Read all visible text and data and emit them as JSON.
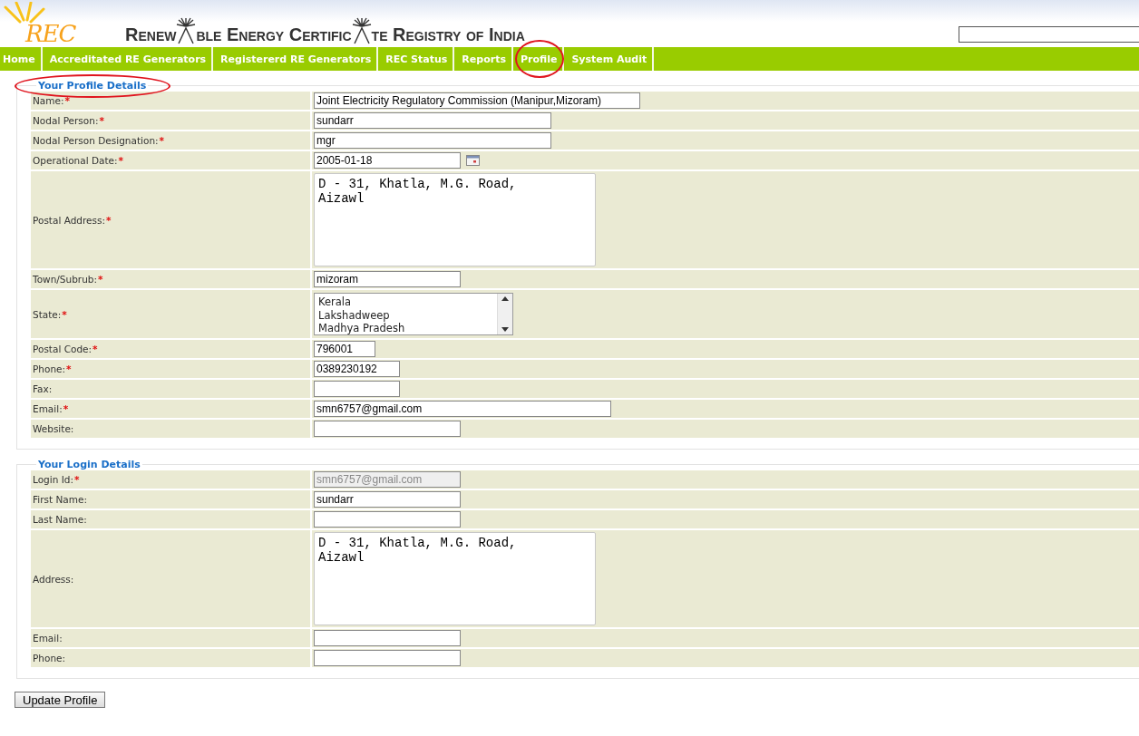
{
  "header": {
    "logo": "REC",
    "title_parts": [
      "Renew",
      "ble Energy Certific",
      "te Registry of India"
    ]
  },
  "nav": [
    {
      "label": "Home",
      "circled": false
    },
    {
      "label": "Accreditated RE Generators",
      "circled": false
    },
    {
      "label": "Registererd RE Generators",
      "circled": false
    },
    {
      "label": "REC Status",
      "circled": false
    },
    {
      "label": "Reports",
      "circled": false
    },
    {
      "label": "Profile",
      "circled": true
    },
    {
      "label": "System Audit",
      "circled": false
    }
  ],
  "sections": [
    {
      "title": "Your Profile Details",
      "circled": true,
      "rows": [
        {
          "kind": "text",
          "label": "Name:",
          "required_mark": "*",
          "value": "Joint Electricity Regulatory Commission (Manipur,Mizoram)"
        },
        {
          "kind": "text",
          "label": "Nodal Person:",
          "required_mark": "*",
          "value": "sundarr"
        },
        {
          "kind": "text",
          "label": "Nodal Person Designation:",
          "required_mark": "*",
          "value": "mgr"
        },
        {
          "kind": "date",
          "label": "Operational Date:",
          "required_mark": "*",
          "value": "2005-01-18"
        },
        {
          "kind": "textarea",
          "label": "Postal Address:",
          "required_mark": "*",
          "value": "D - 31, Khatla, M.G. Road, Aizawl"
        },
        {
          "kind": "text",
          "label": "Town/Subrub:",
          "required_mark": "*",
          "value": "mizoram"
        },
        {
          "kind": "select",
          "label": "State:",
          "required_mark": "*",
          "options": [
            "Kerala",
            "Lakshadweep",
            "Madhya Pradesh"
          ]
        },
        {
          "kind": "text",
          "label": "Postal Code:",
          "required_mark": "*",
          "value": "796001"
        },
        {
          "kind": "text",
          "label": "Phone:",
          "required_mark": "*",
          "value": "0389230192"
        },
        {
          "kind": "text",
          "label": "Fax:"
        },
        {
          "kind": "text",
          "label": "Email:",
          "required_mark": "*",
          "value": "smn6757@gmail.com"
        },
        {
          "kind": "text",
          "label": "Website:"
        }
      ]
    },
    {
      "title": "Your Login Details",
      "circled": false,
      "rows": [
        {
          "kind": "text",
          "label": "Login Id:",
          "required_mark": "*",
          "value": "smn6757@gmail.com",
          "disabled": true
        },
        {
          "kind": "text",
          "label": "First Name:",
          "value": "sundarr"
        },
        {
          "kind": "text",
          "label": "Last Name:"
        },
        {
          "kind": "textarea",
          "label": "Address:",
          "value": "D - 31, Khatla, M.G. Road, Aizawl"
        },
        {
          "kind": "text",
          "label": "Email:"
        },
        {
          "kind": "text",
          "label": "Phone:"
        }
      ]
    }
  ],
  "submit": "Update Profile"
}
